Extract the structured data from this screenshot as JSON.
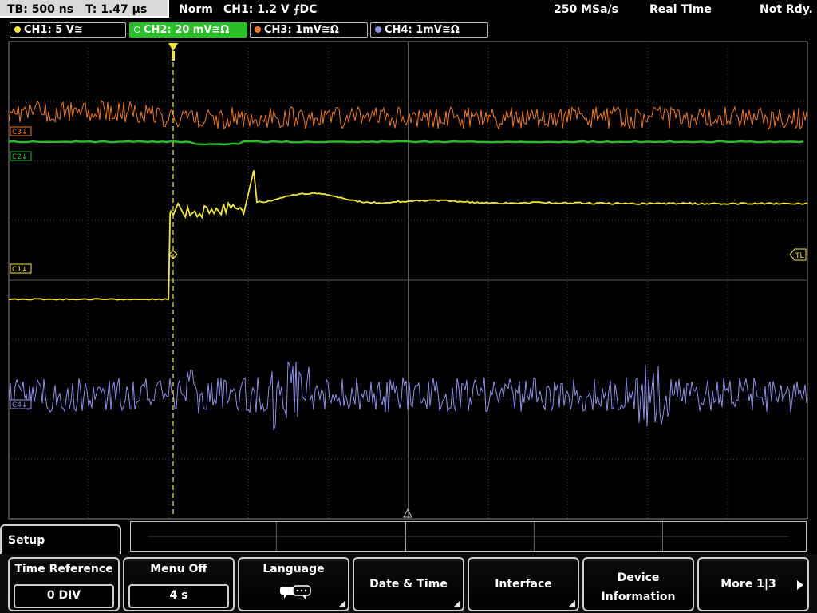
{
  "top_bar": {
    "timebase": "TB: 500 ns",
    "trigger_offset": "T: 1.47 µs",
    "trigger_mode": "Norm",
    "trigger_setting": "CH1: 1.2 V ⨍DC",
    "sample_rate": "250 MSa/s",
    "acq_mode": "Real Time",
    "status": "Not Rdy."
  },
  "channels": [
    {
      "label": "CH1: 5 V≅",
      "color": "#f5ea2c",
      "active": false
    },
    {
      "label": "CH2: 20 mV≅Ω",
      "color": "#27c027",
      "active": true
    },
    {
      "label": "CH3: 1mV≅Ω",
      "color": "#f47a20",
      "active": false
    },
    {
      "label": "CH4: 1mV≅Ω",
      "color": "#9090ee",
      "active": false
    }
  ],
  "markers": {
    "c3": "C3↓",
    "c2": "C2↓",
    "c1": "C1↓",
    "c4": "C4↓",
    "trigger_level": "TL"
  },
  "trigger_position": 0.2,
  "waveforms": {
    "ch1": {
      "color": "#f5ea2c",
      "baseline_level": 0.46,
      "step_level": 0.73,
      "settled_level": 0.66
    },
    "ch2": {
      "color": "#27c027",
      "level": 0.79
    },
    "ch3": {
      "color": "#f47a20",
      "level": 0.84
    },
    "ch4": {
      "color": "#9090ee",
      "level": 0.26
    }
  },
  "menu": {
    "title": "Setup",
    "softkeys": [
      {
        "label": "Time Reference",
        "value": "0 DIV"
      },
      {
        "label": "Menu Off",
        "value": "4 s"
      },
      {
        "label": "Language",
        "icon": "speech-bubbles-icon"
      },
      {
        "label": "Date & Time"
      },
      {
        "label": "Interface"
      },
      {
        "label_line1": "Device",
        "label_line2": "Information"
      },
      {
        "label": "More 1|3"
      }
    ]
  }
}
